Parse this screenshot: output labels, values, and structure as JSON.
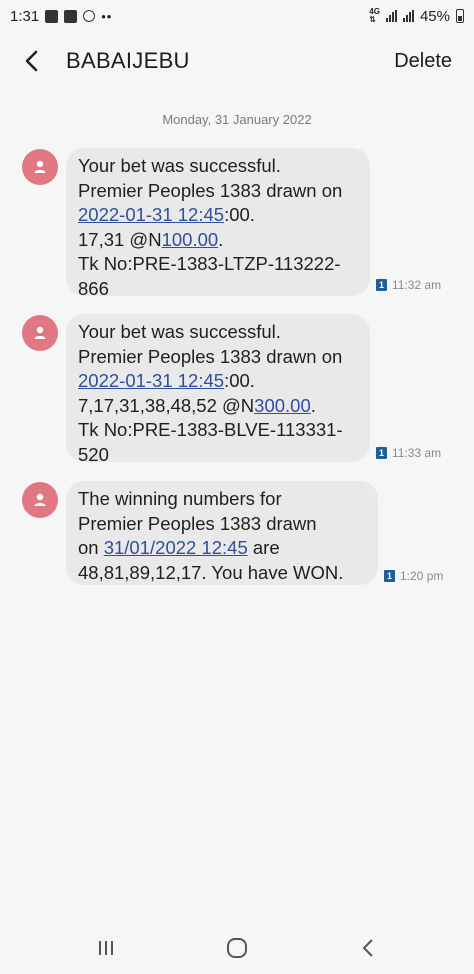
{
  "status_bar": {
    "time": "1:31",
    "dots": "••",
    "network_top": "4G",
    "battery": "45%"
  },
  "header": {
    "title": "BABAIJEBU",
    "delete_label": "Delete"
  },
  "date_separator": "Monday, 31 January 2022",
  "messages": [
    {
      "lines": [
        {
          "text": "Your bet was successful."
        },
        {
          "text": "Premier Peoples 1383 drawn on"
        },
        {
          "link": "2022-01-31 12:45",
          "after": ":00."
        },
        {
          "before": "17,31 @N",
          "link": "100.00",
          "after": "."
        },
        {
          "text": "Tk No:PRE-1383-LTZP-113222-"
        },
        {
          "text": "866"
        }
      ],
      "sim": "1",
      "time": "11:32 am"
    },
    {
      "lines": [
        {
          "text": "Your bet was successful."
        },
        {
          "text": "Premier Peoples 1383 drawn on"
        },
        {
          "link": "2022-01-31 12:45",
          "after": ":00."
        },
        {
          "before": "7,17,31,38,48,52 @N",
          "link": "300.00",
          "after": "."
        },
        {
          "text": "Tk No:PRE-1383-BLVE-113331-"
        },
        {
          "text": "520"
        }
      ],
      "sim": "1",
      "time": "11:33 am"
    },
    {
      "lines": [
        {
          "text": "The winning numbers for"
        },
        {
          "text": "Premier Peoples 1383 drawn"
        },
        {
          "before": "on ",
          "link": "31/01/2022 12:45",
          "after": " are"
        },
        {
          "text": "48,81,89,12,17. You have WON."
        }
      ],
      "sim": "1",
      "time": "1:20 pm"
    }
  ],
  "icons": {
    "avatar": "person-icon",
    "back": "chevron-left-icon",
    "nav_recents": "recents-icon",
    "nav_home": "home-icon",
    "nav_back": "back-icon"
  },
  "colors": {
    "avatar": "#e07782",
    "link": "#2f4f9d",
    "bubble": "#e9e9e9",
    "sim_badge": "#1f5e99"
  }
}
